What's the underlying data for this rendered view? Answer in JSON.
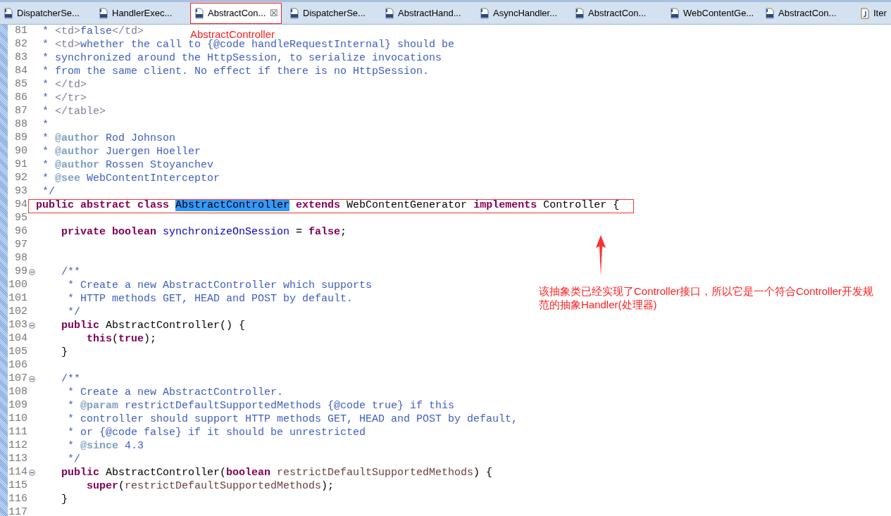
{
  "tabs": [
    {
      "label": "DispatcherSe...",
      "kind": "class",
      "selected": false
    },
    {
      "label": "HandlerExec...",
      "kind": "class",
      "selected": false
    },
    {
      "label": "AbstractCon...",
      "kind": "class",
      "selected": true,
      "close": "☒"
    },
    {
      "label": "DispatcherSe...",
      "kind": "class",
      "selected": false
    },
    {
      "label": "AbstractHand...",
      "kind": "class",
      "selected": false
    },
    {
      "label": "AsyncHandler...",
      "kind": "class",
      "selected": false
    },
    {
      "label": "AbstractCon...",
      "kind": "class",
      "selected": false
    },
    {
      "label": "WebContentGe...",
      "kind": "class",
      "selected": false
    },
    {
      "label": "AbstractCon...",
      "kind": "class",
      "selected": false
    },
    {
      "label": "Iter",
      "kind": "java",
      "selected": false
    }
  ],
  "code_lines": [
    {
      "number": "81",
      "fold": false,
      "segments": [
        {
          "kind": "doc",
          "text": " * "
        },
        {
          "kind": "html",
          "text": "<td>"
        },
        {
          "kind": "doc",
          "text": "false"
        },
        {
          "kind": "html",
          "text": "</td>"
        }
      ]
    },
    {
      "number": "82",
      "fold": false,
      "segments": [
        {
          "kind": "doc",
          "text": " * "
        },
        {
          "kind": "html",
          "text": "<td>"
        },
        {
          "kind": "doc",
          "text": "whether the call to {@code handleRequestInternal} should be"
        }
      ]
    },
    {
      "number": "83",
      "fold": false,
      "segments": [
        {
          "kind": "doc",
          "text": " * synchronized around the HttpSession, to serialize invocations"
        }
      ]
    },
    {
      "number": "84",
      "fold": false,
      "segments": [
        {
          "kind": "doc",
          "text": " * from the same client. No effect if there is no HttpSession."
        }
      ]
    },
    {
      "number": "85",
      "fold": false,
      "segments": [
        {
          "kind": "doc",
          "text": " * "
        },
        {
          "kind": "html",
          "text": "</td>"
        }
      ]
    },
    {
      "number": "86",
      "fold": false,
      "segments": [
        {
          "kind": "doc",
          "text": " * "
        },
        {
          "kind": "html",
          "text": "</tr>"
        }
      ]
    },
    {
      "number": "87",
      "fold": false,
      "segments": [
        {
          "kind": "doc",
          "text": " * "
        },
        {
          "kind": "html",
          "text": "</table>"
        }
      ]
    },
    {
      "number": "88",
      "fold": false,
      "segments": [
        {
          "kind": "doc",
          "text": " *"
        }
      ]
    },
    {
      "number": "89",
      "fold": false,
      "segments": [
        {
          "kind": "doc",
          "text": " * "
        },
        {
          "kind": "tag",
          "text": "@author"
        },
        {
          "kind": "doc",
          "text": " Rod Johnson"
        }
      ]
    },
    {
      "number": "90",
      "fold": false,
      "segments": [
        {
          "kind": "doc",
          "text": " * "
        },
        {
          "kind": "tag",
          "text": "@author"
        },
        {
          "kind": "doc",
          "text": " Juergen Hoeller"
        }
      ]
    },
    {
      "number": "91",
      "fold": false,
      "segments": [
        {
          "kind": "doc",
          "text": " * "
        },
        {
          "kind": "tag",
          "text": "@author"
        },
        {
          "kind": "doc",
          "text": " Rossen Stoyanchev"
        }
      ]
    },
    {
      "number": "92",
      "fold": false,
      "segments": [
        {
          "kind": "doc",
          "text": " * "
        },
        {
          "kind": "tag",
          "text": "@see"
        },
        {
          "kind": "doc",
          "text": " WebContentInterceptor"
        }
      ]
    },
    {
      "number": "93",
      "fold": false,
      "segments": [
        {
          "kind": "doc",
          "text": " */"
        }
      ]
    },
    {
      "number": "94",
      "fold": false,
      "segments": [
        {
          "kind": "keyword",
          "text": "public abstract class "
        },
        {
          "kind": "selection",
          "text": "AbstractController"
        },
        {
          "kind": "keyword",
          "text": " extends"
        },
        {
          "kind": "plain",
          "text": " WebContentGenerator "
        },
        {
          "kind": "keyword",
          "text": "implements"
        },
        {
          "kind": "plain",
          "text": " Controller {"
        }
      ]
    },
    {
      "number": "95",
      "fold": false
    },
    {
      "number": "96",
      "fold": false,
      "segments": [
        {
          "kind": "keyword",
          "text": "    private boolean "
        },
        {
          "kind": "field",
          "text": "synchronizeOnSession"
        },
        {
          "kind": "plain",
          "text": " = "
        },
        {
          "kind": "keyword",
          "text": "false"
        },
        {
          "kind": "plain",
          "text": ";"
        }
      ]
    },
    {
      "number": "97",
      "fold": false
    },
    {
      "number": "98",
      "fold": false
    },
    {
      "number": "99",
      "fold": true,
      "segments": [
        {
          "kind": "doc",
          "text": "    /**"
        }
      ]
    },
    {
      "number": "100",
      "fold": false,
      "segments": [
        {
          "kind": "doc",
          "text": "     * Create a new AbstractController which supports"
        }
      ]
    },
    {
      "number": "101",
      "fold": false,
      "segments": [
        {
          "kind": "doc",
          "text": "     * HTTP methods GET, HEAD and POST by default."
        }
      ]
    },
    {
      "number": "102",
      "fold": false,
      "segments": [
        {
          "kind": "doc",
          "text": "     */"
        }
      ]
    },
    {
      "number": "103",
      "fold": true,
      "segments": [
        {
          "kind": "keyword",
          "text": "    public"
        },
        {
          "kind": "plain",
          "text": " AbstractController() {"
        }
      ]
    },
    {
      "number": "104",
      "fold": false,
      "segments": [
        {
          "kind": "keyword",
          "text": "        this"
        },
        {
          "kind": "plain",
          "text": "("
        },
        {
          "kind": "keyword",
          "text": "true"
        },
        {
          "kind": "plain",
          "text": ");"
        }
      ]
    },
    {
      "number": "105",
      "fold": false,
      "segments": [
        {
          "kind": "plain",
          "text": "    }"
        }
      ]
    },
    {
      "number": "106",
      "fold": false
    },
    {
      "number": "107",
      "fold": true,
      "segments": [
        {
          "kind": "doc",
          "text": "    /**"
        }
      ]
    },
    {
      "number": "108",
      "fold": false,
      "segments": [
        {
          "kind": "doc",
          "text": "     * Create a new AbstractController."
        }
      ]
    },
    {
      "number": "109",
      "fold": false,
      "segments": [
        {
          "kind": "doc",
          "text": "     * "
        },
        {
          "kind": "tag",
          "text": "@param"
        },
        {
          "kind": "doc",
          "text": " restrictDefaultSupportedMethods {@code true} if this"
        }
      ]
    },
    {
      "number": "110",
      "fold": false,
      "segments": [
        {
          "kind": "doc",
          "text": "     * controller should support HTTP methods GET, HEAD and POST by default,"
        }
      ]
    },
    {
      "number": "111",
      "fold": false,
      "segments": [
        {
          "kind": "doc",
          "text": "     * or {@code false} if it should be unrestricted"
        }
      ]
    },
    {
      "number": "112",
      "fold": false,
      "segments": [
        {
          "kind": "doc",
          "text": "     * "
        },
        {
          "kind": "tag",
          "text": "@since"
        },
        {
          "kind": "doc",
          "text": " 4.3"
        }
      ]
    },
    {
      "number": "113",
      "fold": false,
      "segments": [
        {
          "kind": "doc",
          "text": "     */"
        }
      ]
    },
    {
      "number": "114",
      "fold": true,
      "segments": [
        {
          "kind": "keyword",
          "text": "    public"
        },
        {
          "kind": "plain",
          "text": " AbstractController("
        },
        {
          "kind": "keyword",
          "text": "boolean "
        },
        {
          "kind": "param",
          "text": "restrictDefaultSupportedMethods"
        },
        {
          "kind": "plain",
          "text": ") {"
        }
      ]
    },
    {
      "number": "115",
      "fold": false,
      "segments": [
        {
          "kind": "keyword",
          "text": "        super"
        },
        {
          "kind": "plain",
          "text": "("
        },
        {
          "kind": "param",
          "text": "restrictDefaultSupportedMethods"
        },
        {
          "kind": "plain",
          "text": ");"
        }
      ]
    },
    {
      "number": "116",
      "fold": false,
      "segments": [
        {
          "kind": "plain",
          "text": "    }"
        }
      ]
    },
    {
      "number": "117",
      "fold": false
    }
  ],
  "annotations": {
    "tab_callout": "AbstractController",
    "note": "该抽象类已经实现了Controller接口，所以它是一个符合Controller开发规范的抽象Handler(处理器)"
  }
}
